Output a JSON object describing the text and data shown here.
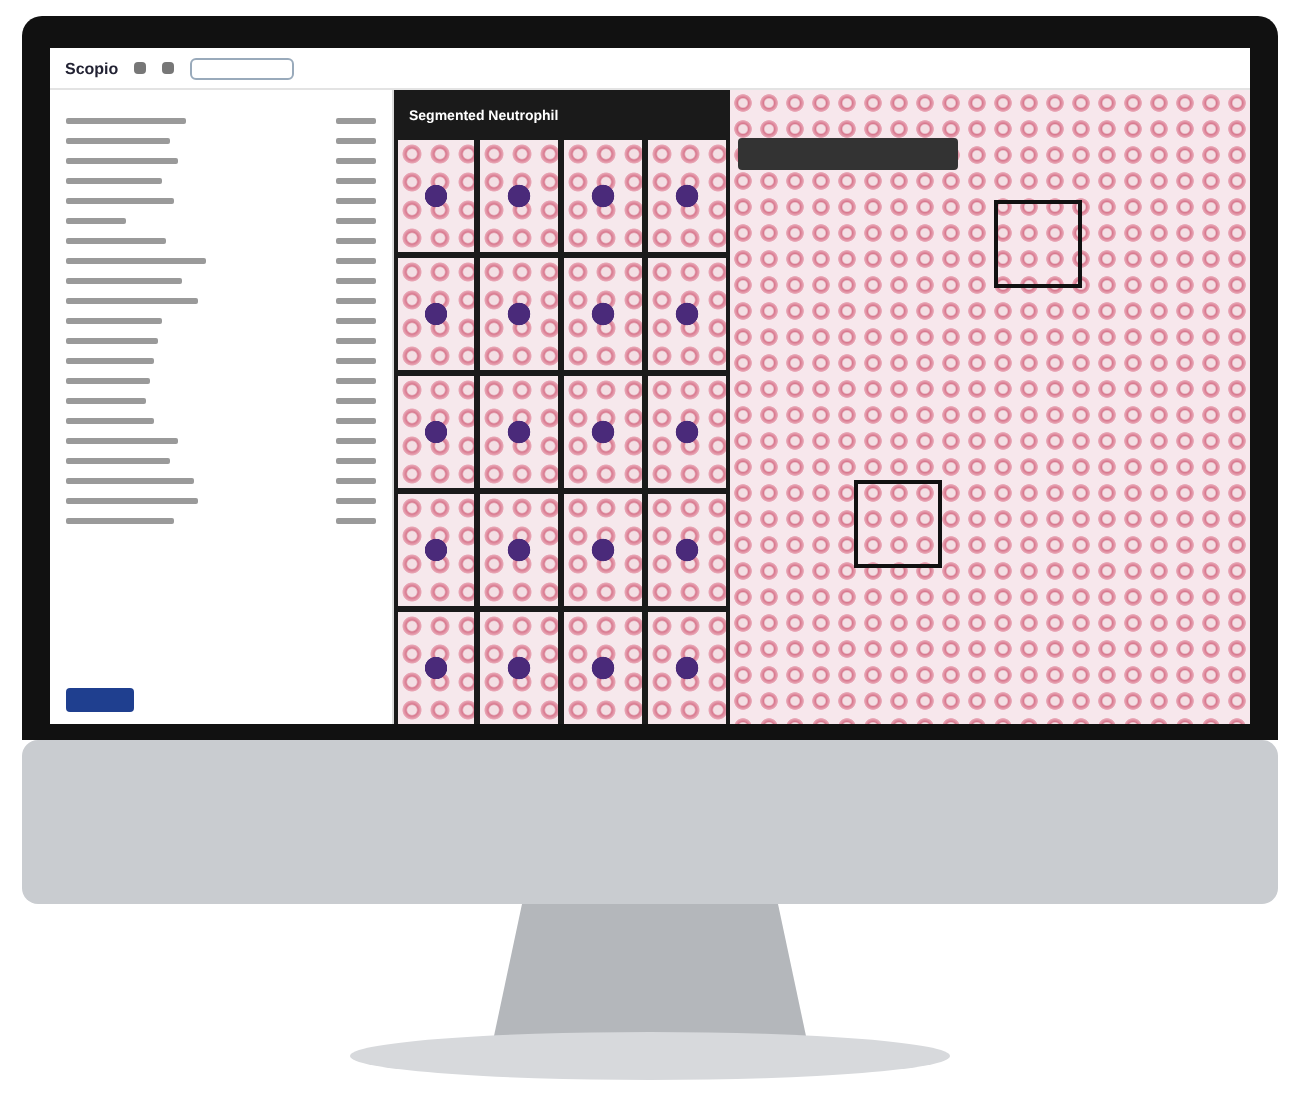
{
  "app": {
    "logo": "Scopio"
  },
  "gallery": {
    "title": "Segmented Neutrophil"
  }
}
